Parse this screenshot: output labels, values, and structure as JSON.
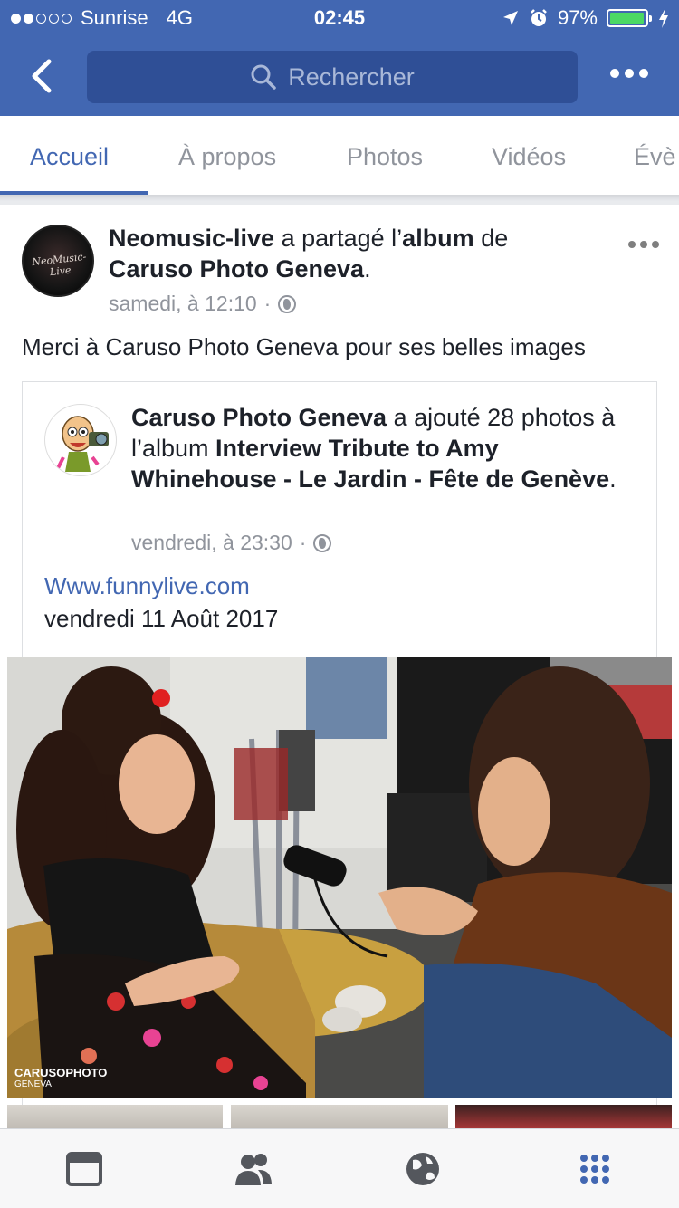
{
  "status_bar": {
    "carrier": "Sunrise",
    "network": "4G",
    "time": "02:45",
    "battery": "97%",
    "battery_level": 0.97
  },
  "nav": {
    "search_placeholder": "Rechercher"
  },
  "tabs": [
    "Accueil",
    "À propos",
    "Photos",
    "Vidéos",
    "Évè"
  ],
  "active_tab": "Accueil",
  "post": {
    "author": "Neomusic-live",
    "action_prefix": " a partagé l’",
    "action_object": "album",
    "action_suffix": " de",
    "target": "Caruso Photo Geneva",
    "target_suffix": ".",
    "time": "samedi, à 12:10",
    "separator": "·",
    "caption": "Merci à Caruso Photo Geneva pour ses belles images",
    "avatar_logo_text": "NeoMusic-Live"
  },
  "shared": {
    "author": "Caruso Photo Geneva",
    "action": " a ajouté 28 photos à l’album ",
    "album": "Interview Tribute to Amy Whinehouse - Le Jardin - Fête de Genève",
    "album_suffix": ".",
    "time": "vendredi, à 23:30",
    "separator": "·",
    "link": "Www.funnylive.com",
    "date": "vendredi 11 Août 2017"
  },
  "photo": {
    "watermark": "CARUSOPHOTO",
    "watermark_sub": "GENEVA"
  },
  "colors": {
    "brand": "#4267b2",
    "text": "#1d2129",
    "meta": "#90949c"
  },
  "tab_bar_icons": [
    "news-feed-icon",
    "friends-icon",
    "globe-icon",
    "menu-grid-icon"
  ]
}
